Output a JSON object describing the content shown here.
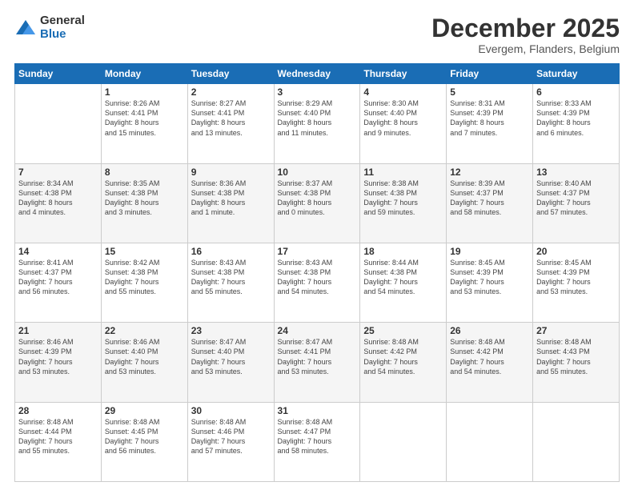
{
  "header": {
    "logo_general": "General",
    "logo_blue": "Blue",
    "month_title": "December 2025",
    "location": "Evergem, Flanders, Belgium"
  },
  "weekdays": [
    "Sunday",
    "Monday",
    "Tuesday",
    "Wednesday",
    "Thursday",
    "Friday",
    "Saturday"
  ],
  "weeks": [
    [
      {
        "day": "",
        "info": ""
      },
      {
        "day": "1",
        "info": "Sunrise: 8:26 AM\nSunset: 4:41 PM\nDaylight: 8 hours\nand 15 minutes."
      },
      {
        "day": "2",
        "info": "Sunrise: 8:27 AM\nSunset: 4:41 PM\nDaylight: 8 hours\nand 13 minutes."
      },
      {
        "day": "3",
        "info": "Sunrise: 8:29 AM\nSunset: 4:40 PM\nDaylight: 8 hours\nand 11 minutes."
      },
      {
        "day": "4",
        "info": "Sunrise: 8:30 AM\nSunset: 4:40 PM\nDaylight: 8 hours\nand 9 minutes."
      },
      {
        "day": "5",
        "info": "Sunrise: 8:31 AM\nSunset: 4:39 PM\nDaylight: 8 hours\nand 7 minutes."
      },
      {
        "day": "6",
        "info": "Sunrise: 8:33 AM\nSunset: 4:39 PM\nDaylight: 8 hours\nand 6 minutes."
      }
    ],
    [
      {
        "day": "7",
        "info": "Sunrise: 8:34 AM\nSunset: 4:38 PM\nDaylight: 8 hours\nand 4 minutes."
      },
      {
        "day": "8",
        "info": "Sunrise: 8:35 AM\nSunset: 4:38 PM\nDaylight: 8 hours\nand 3 minutes."
      },
      {
        "day": "9",
        "info": "Sunrise: 8:36 AM\nSunset: 4:38 PM\nDaylight: 8 hours\nand 1 minute."
      },
      {
        "day": "10",
        "info": "Sunrise: 8:37 AM\nSunset: 4:38 PM\nDaylight: 8 hours\nand 0 minutes."
      },
      {
        "day": "11",
        "info": "Sunrise: 8:38 AM\nSunset: 4:38 PM\nDaylight: 7 hours\nand 59 minutes."
      },
      {
        "day": "12",
        "info": "Sunrise: 8:39 AM\nSunset: 4:37 PM\nDaylight: 7 hours\nand 58 minutes."
      },
      {
        "day": "13",
        "info": "Sunrise: 8:40 AM\nSunset: 4:37 PM\nDaylight: 7 hours\nand 57 minutes."
      }
    ],
    [
      {
        "day": "14",
        "info": "Sunrise: 8:41 AM\nSunset: 4:37 PM\nDaylight: 7 hours\nand 56 minutes."
      },
      {
        "day": "15",
        "info": "Sunrise: 8:42 AM\nSunset: 4:38 PM\nDaylight: 7 hours\nand 55 minutes."
      },
      {
        "day": "16",
        "info": "Sunrise: 8:43 AM\nSunset: 4:38 PM\nDaylight: 7 hours\nand 55 minutes."
      },
      {
        "day": "17",
        "info": "Sunrise: 8:43 AM\nSunset: 4:38 PM\nDaylight: 7 hours\nand 54 minutes."
      },
      {
        "day": "18",
        "info": "Sunrise: 8:44 AM\nSunset: 4:38 PM\nDaylight: 7 hours\nand 54 minutes."
      },
      {
        "day": "19",
        "info": "Sunrise: 8:45 AM\nSunset: 4:39 PM\nDaylight: 7 hours\nand 53 minutes."
      },
      {
        "day": "20",
        "info": "Sunrise: 8:45 AM\nSunset: 4:39 PM\nDaylight: 7 hours\nand 53 minutes."
      }
    ],
    [
      {
        "day": "21",
        "info": "Sunrise: 8:46 AM\nSunset: 4:39 PM\nDaylight: 7 hours\nand 53 minutes."
      },
      {
        "day": "22",
        "info": "Sunrise: 8:46 AM\nSunset: 4:40 PM\nDaylight: 7 hours\nand 53 minutes."
      },
      {
        "day": "23",
        "info": "Sunrise: 8:47 AM\nSunset: 4:40 PM\nDaylight: 7 hours\nand 53 minutes."
      },
      {
        "day": "24",
        "info": "Sunrise: 8:47 AM\nSunset: 4:41 PM\nDaylight: 7 hours\nand 53 minutes."
      },
      {
        "day": "25",
        "info": "Sunrise: 8:48 AM\nSunset: 4:42 PM\nDaylight: 7 hours\nand 54 minutes."
      },
      {
        "day": "26",
        "info": "Sunrise: 8:48 AM\nSunset: 4:42 PM\nDaylight: 7 hours\nand 54 minutes."
      },
      {
        "day": "27",
        "info": "Sunrise: 8:48 AM\nSunset: 4:43 PM\nDaylight: 7 hours\nand 55 minutes."
      }
    ],
    [
      {
        "day": "28",
        "info": "Sunrise: 8:48 AM\nSunset: 4:44 PM\nDaylight: 7 hours\nand 55 minutes."
      },
      {
        "day": "29",
        "info": "Sunrise: 8:48 AM\nSunset: 4:45 PM\nDaylight: 7 hours\nand 56 minutes."
      },
      {
        "day": "30",
        "info": "Sunrise: 8:48 AM\nSunset: 4:46 PM\nDaylight: 7 hours\nand 57 minutes."
      },
      {
        "day": "31",
        "info": "Sunrise: 8:48 AM\nSunset: 4:47 PM\nDaylight: 7 hours\nand 58 minutes."
      },
      {
        "day": "",
        "info": ""
      },
      {
        "day": "",
        "info": ""
      },
      {
        "day": "",
        "info": ""
      }
    ]
  ]
}
